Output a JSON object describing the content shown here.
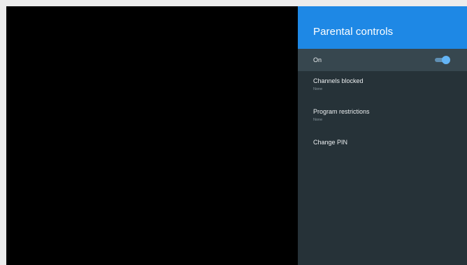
{
  "panel": {
    "title": "Parental controls",
    "on_row": {
      "label": "On",
      "toggle_state": "on",
      "toggle_color": "#64b5f6"
    },
    "items": [
      {
        "label": "Channels blocked",
        "subtitle": "None"
      },
      {
        "label": "Program restrictions",
        "subtitle": "None"
      },
      {
        "label": "Change PIN"
      }
    ]
  },
  "colors": {
    "accent": "#1e88e5",
    "panel_bg": "#263238",
    "selected_row_bg": "#37474f"
  }
}
